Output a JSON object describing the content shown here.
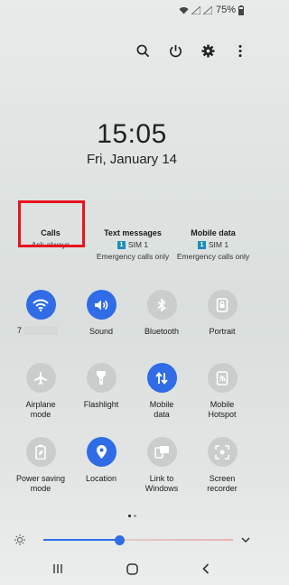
{
  "status_bar": {
    "battery": "75%"
  },
  "clock": {
    "time": "15:05",
    "date": "Fri, January 14"
  },
  "sim_settings": {
    "calls": {
      "title": "Calls",
      "value": "Ask always"
    },
    "text_messages": {
      "title": "Text messages",
      "sim_badge": "1",
      "sim_name": "SIM 1",
      "note": "Emergency calls only"
    },
    "mobile_data": {
      "title": "Mobile data",
      "sim_badge": "1",
      "sim_name": "SIM 1",
      "note": "Emergency calls only"
    }
  },
  "tiles": {
    "wifi": {
      "label": "7",
      "state": "on",
      "icon": "wifi-icon"
    },
    "sound": {
      "label": "Sound",
      "state": "on",
      "icon": "speaker-icon"
    },
    "bluetooth": {
      "label": "Bluetooth",
      "state": "off",
      "icon": "bluetooth-icon"
    },
    "portrait": {
      "label": "Portrait",
      "state": "off",
      "icon": "portrait-lock-icon"
    },
    "airplane": {
      "label": "Airplane\nmode",
      "state": "off",
      "icon": "airplane-icon"
    },
    "flashlight": {
      "label": "Flashlight",
      "state": "off",
      "icon": "flashlight-icon"
    },
    "mobile_data": {
      "label": "Mobile\ndata",
      "state": "on",
      "icon": "data-arrows-icon"
    },
    "hotspot": {
      "label": "Mobile\nHotspot",
      "state": "off",
      "icon": "hotspot-icon"
    },
    "power_saving": {
      "label": "Power saving\nmode",
      "state": "off",
      "icon": "battery-leaf-icon"
    },
    "location": {
      "label": "Location",
      "state": "on",
      "icon": "location-pin-icon"
    },
    "link_windows": {
      "label": "Link to\nWindows",
      "state": "off",
      "icon": "link-windows-icon"
    },
    "screen_recorder": {
      "label": "Screen\nrecorder",
      "state": "off",
      "icon": "screen-recorder-icon"
    }
  },
  "brightness": {
    "level": 0.4
  },
  "colors": {
    "accent": "#2f6ce6",
    "highlight_box": "#e8141e",
    "tile_off": "#c9cdcc"
  }
}
